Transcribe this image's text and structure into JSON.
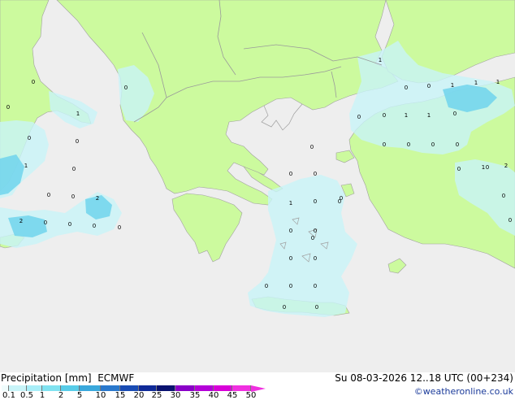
{
  "title": {
    "left": "Precipitation [mm]  ECMWF",
    "right": "Su 08-03-2026 12..18 UTC (00+234)"
  },
  "credit": "©weatheronline.co.uk",
  "legend": {
    "ticks": [
      "0.1",
      "0.5",
      "1",
      "2",
      "5",
      "10",
      "15",
      "20",
      "25",
      "30",
      "35",
      "40",
      "45",
      "50"
    ],
    "colors": [
      "#f0fcfc",
      "#c8f4f8",
      "#a8eef8",
      "#80e2f0",
      "#58cce8",
      "#3aa8dc",
      "#2a78cc",
      "#1a4cb4",
      "#0f2a98",
      "#0a1270",
      "#8a00c8",
      "#b400d8",
      "#d800d8",
      "#f030e0"
    ]
  },
  "map_colors": {
    "sea": "#eeeeee",
    "land": "#ccfa9e",
    "border": "#9a9a9a",
    "coast": "#a0a0a0",
    "precip_light": "#c8f4f8",
    "precip_mid": "#a8eef8",
    "precip_heavy": "#70d4ec"
  },
  "cell_labels": [
    "1",
    "0",
    "0",
    "1",
    "2",
    "1",
    "0",
    "0",
    "0",
    "0",
    "0",
    "1",
    "1",
    "1",
    "1",
    "0",
    "0",
    "0",
    "0",
    "0",
    "0",
    "0",
    "0",
    "1",
    "0",
    "0",
    "1",
    "2",
    "2",
    "0",
    "0",
    "0",
    "0",
    "0",
    "0",
    "1",
    "0",
    "0",
    "0",
    "0",
    "0",
    "0",
    "0",
    "0",
    "0",
    "0",
    "0",
    "0",
    "0",
    "0",
    "0",
    "0",
    "0",
    "0"
  ]
}
